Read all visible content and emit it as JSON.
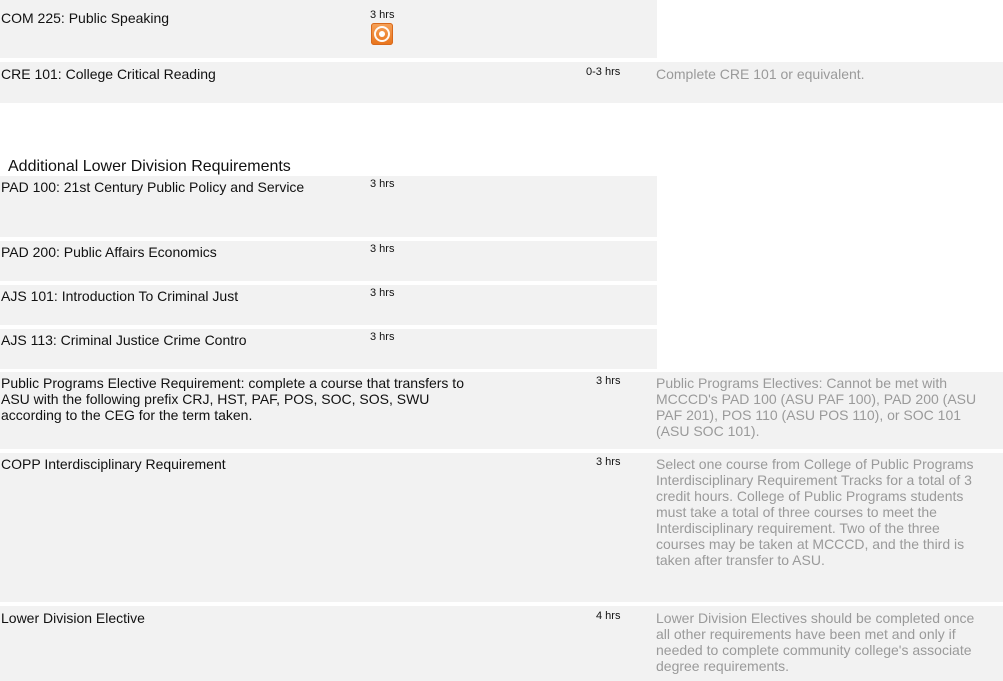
{
  "courses": [
    {
      "name": "COM 225: Public Speaking",
      "hours": "3 hrs",
      "note": ""
    },
    {
      "name": "CRE 101: College Critical Reading",
      "hours": "0-3 hrs",
      "note": "Complete CRE 101 or equivalent."
    }
  ],
  "section": {
    "title": "Additional Lower Division Requirements"
  },
  "requirements": [
    {
      "name": "PAD 100: 21st Century Public Policy and Service",
      "hours": "3 hrs"
    },
    {
      "name": "PAD 200: Public Affairs Economics",
      "hours": "3 hrs"
    },
    {
      "name": "AJS 101: Introduction To Criminal Just",
      "hours": "3 hrs"
    },
    {
      "name": "AJS 113: Criminal Justice Crime Contro",
      "hours": "3 hrs"
    },
    {
      "name": "Public Programs Elective Requirement: complete a course that transfers to ASU with the following prefix CRJ, HST, PAF, POS, SOC, SOS, SWU according to the CEG for the term taken.",
      "hours": "3 hrs",
      "note": "Public Programs Electives: Cannot be met with MCCCD's PAD 100 (ASU PAF 100), PAD 200 (ASU PAF 201), POS 110 (ASU POS 110), or SOC 101 (ASU SOC 101)."
    },
    {
      "name": "COPP Interdisciplinary Requirement",
      "hours": "3 hrs",
      "note": "Select one course from College of Public Programs Interdisciplinary Requirement Tracks for a total of 3 credit hours. College of Public Programs students must take a total of three courses to meet the Interdisciplinary requirement. Two of the three courses may be taken at MCCCD, and the third is taken after transfer to ASU."
    },
    {
      "name": "Lower Division Elective",
      "hours": "4 hrs",
      "note": "Lower Division Electives should be completed once all other requirements have been met and only if needed to complete community college's associate degree requirements."
    }
  ]
}
